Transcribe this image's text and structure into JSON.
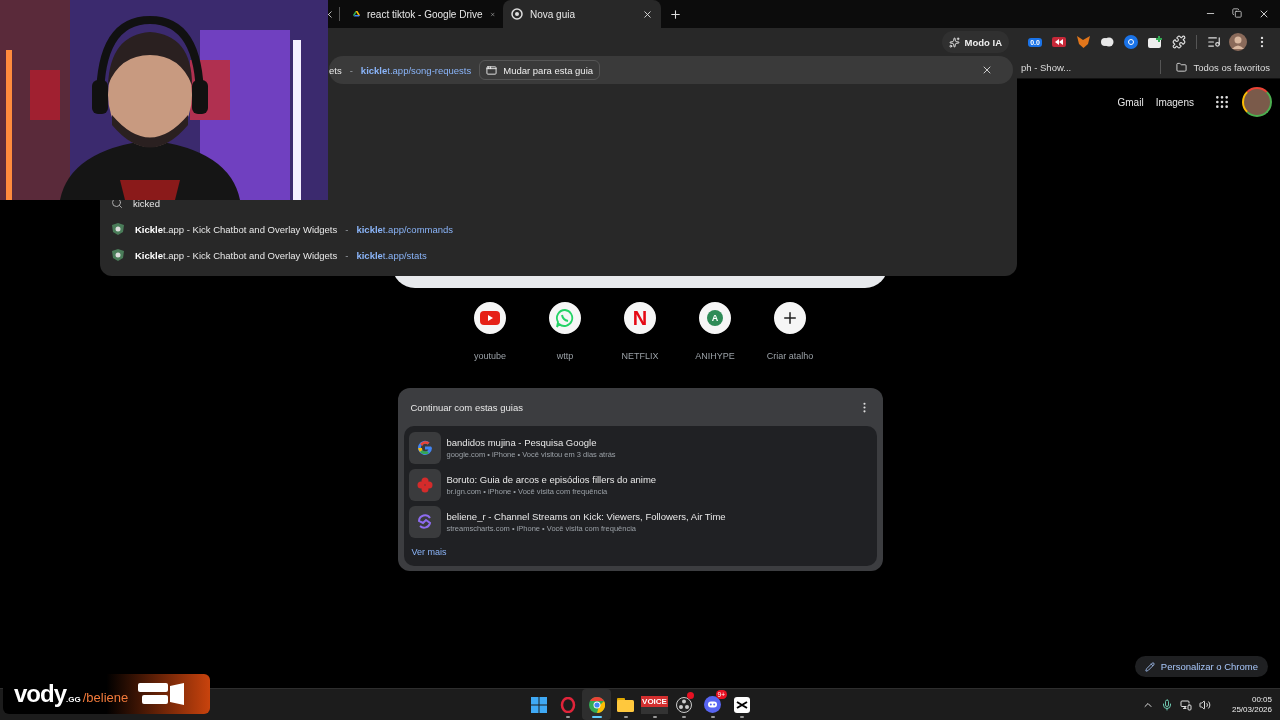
{
  "tabs": [
    {
      "kind": "drive",
      "title": "react tiktok - Google Drive",
      "selected": false
    },
    {
      "kind": "chrome",
      "title": "Nova guia",
      "selected": true
    }
  ],
  "omnibox": {
    "mode_button": "Modo IA",
    "suggestions": [
      {
        "kind": "tab_match",
        "selected": true,
        "title": "ets",
        "separator": "-",
        "url": "**kickle**t.app/song-requests",
        "action": "Mudar para esta guia"
      },
      {
        "kind": "search",
        "selected": false,
        "title": "kicked"
      },
      {
        "kind": "history",
        "selected": false,
        "title": "**Kickle**t.app - Kick Chatbot and Overlay Widgets",
        "separator": "-",
        "url": "**kickle**t.app/commands"
      },
      {
        "kind": "history",
        "selected": false,
        "title": "**Kickle**t.app - Kick Chatbot and Overlay Widgets",
        "separator": "-",
        "url": "**kickle**t.app/stats"
      }
    ]
  },
  "extensions": [
    {
      "kind": "counter",
      "label": "0.0"
    },
    {
      "kind": "rewind"
    },
    {
      "kind": "fox"
    },
    {
      "kind": "cloud"
    },
    {
      "kind": "lens"
    },
    {
      "kind": "folder_plus"
    },
    {
      "kind": "puzzle"
    },
    {
      "kind": "media"
    },
    {
      "kind": "profile"
    },
    {
      "kind": "menu"
    }
  ],
  "bookmarks": {
    "items": [
      "ph - Show..."
    ],
    "all_label": "Todos os favoritos"
  },
  "google": {
    "links": [
      "Gmail",
      "Imagens"
    ]
  },
  "shortcuts": [
    {
      "kind": "youtube",
      "label": "youtube"
    },
    {
      "kind": "whatsapp",
      "label": "wttp"
    },
    {
      "kind": "letter",
      "letter": "N",
      "color": "#e50914",
      "label": "NETFLIX"
    },
    {
      "kind": "letter",
      "letter": "A",
      "color": "#2e8b57",
      "label": "ANIHYPE"
    },
    {
      "kind": "add",
      "label": "Criar atalho"
    }
  ],
  "tabs_card": {
    "title": "Continuar com estas guias",
    "items": [
      {
        "kind": "google",
        "title": "bandidos mujina - Pesquisa Google",
        "meta": "google.com • iPhone • Você visitou em 3 dias atrás"
      },
      {
        "kind": "ign",
        "title": "Boruto: Guia de arcos e episódios fillers do anime",
        "meta": "br.ign.com • iPhone • Você visita com frequência"
      },
      {
        "kind": "streamcharts",
        "title": "beliene_r - Channel Streams on Kick: Viewers, Followers, Air Time",
        "meta": "streamscharts.com • iPhone • Você visita com frequência"
      }
    ],
    "more": "Ver mais"
  },
  "customize": "Personalizar o Chrome",
  "taskbar": {
    "apps": [
      {
        "kind": "windows",
        "running": false,
        "selected": false,
        "alert": false
      },
      {
        "kind": "opera",
        "running": true,
        "selected": false,
        "alert": false
      },
      {
        "kind": "chrome",
        "running": true,
        "selected": true,
        "alert": false
      },
      {
        "kind": "folder",
        "running": true,
        "selected": false,
        "alert": false
      },
      {
        "kind": "voicemeeter",
        "label": "VOICE",
        "running": true,
        "selected": false,
        "alert": false
      },
      {
        "kind": "obs",
        "running": true,
        "selected": false,
        "alert": true
      },
      {
        "kind": "discord",
        "badge": "9+",
        "running": true,
        "selected": false,
        "alert": false
      },
      {
        "kind": "capcut",
        "running": true,
        "selected": false,
        "alert": false
      }
    ],
    "time": "00:05",
    "date": "25/03/2026"
  },
  "overlay": {
    "brand": "vody",
    "suffix": ".GG",
    "channel": "/beliene"
  }
}
